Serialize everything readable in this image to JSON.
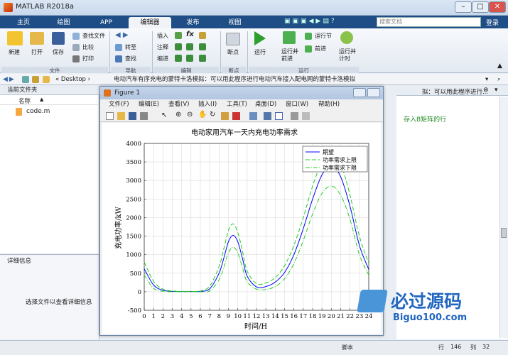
{
  "app": {
    "title": "MATLAB R2018a",
    "win_min": "–",
    "win_max": "□",
    "win_close": "✕"
  },
  "tabs": [
    {
      "label": "主页"
    },
    {
      "label": "绘图"
    },
    {
      "label": "APP"
    },
    {
      "label": "编辑器"
    },
    {
      "label": "发布"
    },
    {
      "label": "视图"
    }
  ],
  "search": {
    "placeholder": "搜索文档",
    "login": "登录"
  },
  "ribbon": {
    "file": {
      "new": "新建",
      "open": "打开",
      "save": "保存",
      "find_files": "查找文件",
      "compare": "比较",
      "print": "打印",
      "group": "文件"
    },
    "nav": {
      "goto": "转至",
      "find": "查找",
      "group": "导航"
    },
    "edit": {
      "insert": "插入",
      "comment": "注释",
      "indent": "缩进",
      "fx": "fx",
      "group": "编辑"
    },
    "breakpoints": {
      "label": "断点",
      "group": "断点"
    },
    "run": {
      "run": "运行",
      "run_advance": "运行并前进",
      "run_section": "运行节",
      "advance": "前进",
      "run_time": "运行并计时",
      "group": "运行"
    }
  },
  "address": {
    "path_prefix": "« Desktop ›",
    "path": "电动汽车有序充电的蒙特卡洛模拟：可以用此程序进行电动汽车接入配电网的蒙特卡洛模拟"
  },
  "left_panel": {
    "header": "当前文件夹",
    "col_name": "名称",
    "sort": "▲",
    "files": [
      "code.m"
    ],
    "detail_header": "详细信息",
    "detail_hint": "选择文件以查看详细信息"
  },
  "right_panel": {
    "title_fragment": "拟：可以用此程序进行...",
    "code_fragment": "存入B矩阵的行"
  },
  "status": {
    "script": "脚本",
    "row_label": "行",
    "row": "146",
    "col_label": "列",
    "col": "32"
  },
  "watermark": {
    "brand": "必过源码",
    "url": "Biguo100.com"
  },
  "figure": {
    "title": "Figure 1",
    "menu": [
      "文件(F)",
      "编辑(E)",
      "查看(V)",
      "插入(I)",
      "工具(T)",
      "桌面(D)",
      "窗口(W)",
      "帮助(H)"
    ]
  },
  "chart_data": {
    "type": "line",
    "title": "电动家用汽车一天内充电功率需求",
    "xlabel": "时间/H",
    "ylabel": "充电功率/kW",
    "xlim": [
      0,
      24
    ],
    "ylim": [
      -500,
      4000
    ],
    "xticks": [
      0,
      1,
      2,
      3,
      4,
      5,
      6,
      7,
      8,
      9,
      10,
      11,
      12,
      13,
      14,
      15,
      16,
      17,
      18,
      19,
      20,
      21,
      22,
      23,
      24
    ],
    "yticks": [
      -500,
      0,
      500,
      1000,
      1500,
      2000,
      2500,
      3000,
      3500,
      4000
    ],
    "grid": true,
    "legend_position": "top-right",
    "x": [
      0,
      1,
      2,
      3,
      4,
      5,
      6,
      7,
      8,
      8.5,
      9,
      9.5,
      10,
      10.5,
      11,
      12,
      13,
      14,
      15,
      16,
      17,
      18,
      19,
      20,
      21,
      22,
      23,
      24
    ],
    "series": [
      {
        "name": "期望",
        "color": "#0000ff",
        "dash": "",
        "values": [
          620,
          180,
          40,
          10,
          5,
          5,
          10,
          80,
          500,
          900,
          1350,
          1520,
          1350,
          900,
          420,
          130,
          140,
          260,
          520,
          1000,
          1700,
          2500,
          3150,
          3400,
          3100,
          2300,
          1250,
          600
        ]
      },
      {
        "name": "功率需求上限",
        "color": "#22cc22",
        "dash": "6,3",
        "values": [
          800,
          280,
          70,
          20,
          10,
          10,
          20,
          150,
          680,
          1150,
          1650,
          1830,
          1600,
          1100,
          560,
          220,
          240,
          380,
          700,
          1250,
          2000,
          2850,
          3500,
          3750,
          3450,
          2600,
          1500,
          770
        ]
      },
      {
        "name": "功率需求下限",
        "color": "#22cc22",
        "dash": "6,2,1,2",
        "values": [
          450,
          90,
          15,
          0,
          0,
          0,
          0,
          20,
          320,
          650,
          1050,
          1200,
          1050,
          650,
          270,
          70,
          60,
          140,
          350,
          760,
          1380,
          2100,
          2650,
          2850,
          2600,
          1950,
          1000,
          450
        ]
      }
    ]
  }
}
